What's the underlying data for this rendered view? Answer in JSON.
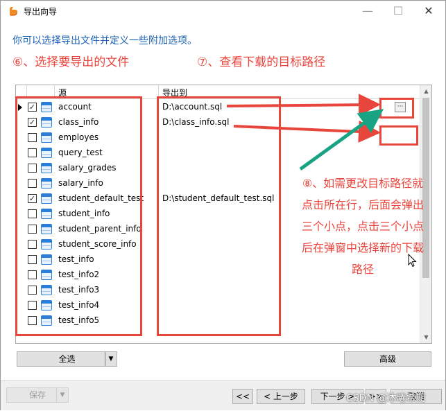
{
  "window": {
    "title": "导出向导"
  },
  "intro": "你可以选择导出文件并定义一些附加选项。",
  "annotations": {
    "step6": "⑥、选择要导出的文件",
    "step7": "⑦、查看下载的目标路径",
    "step8_lines": [
      "⑧、如需更改目标路径就",
      "点击所在行，后面会弹出",
      "三个小点，点击三个小点",
      "后在弹窗中选择新的下载",
      "路径"
    ]
  },
  "grid": {
    "headers": {
      "source": "源",
      "export_to": "导出到"
    },
    "rows": [
      {
        "name": "account",
        "checked": true,
        "dest": "D:\\account.sql",
        "current": true
      },
      {
        "name": "class_info",
        "checked": true,
        "dest": "D:\\class_info.sql"
      },
      {
        "name": "employes",
        "checked": false,
        "dest": ""
      },
      {
        "name": "query_test",
        "checked": false,
        "dest": ""
      },
      {
        "name": "salary_grades",
        "checked": false,
        "dest": ""
      },
      {
        "name": "salary_info",
        "checked": false,
        "dest": ""
      },
      {
        "name": "student_default_test",
        "checked": true,
        "dest": "D:\\student_default_test.sql"
      },
      {
        "name": "student_info",
        "checked": false,
        "dest": ""
      },
      {
        "name": "student_parent_info",
        "checked": false,
        "dest": ""
      },
      {
        "name": "student_score_info",
        "checked": false,
        "dest": ""
      },
      {
        "name": "test_info",
        "checked": false,
        "dest": ""
      },
      {
        "name": "test_info2",
        "checked": false,
        "dest": ""
      },
      {
        "name": "test_info3",
        "checked": false,
        "dest": ""
      },
      {
        "name": "test_info4",
        "checked": false,
        "dest": ""
      },
      {
        "name": "test_info5",
        "checked": false,
        "dest": ""
      }
    ],
    "ellipsis_label": "···"
  },
  "buttons": {
    "select_all": "全选",
    "advanced": "高级",
    "save": "保存",
    "first": "<<",
    "prev": "< 上一步",
    "next": "下一步 >",
    "last": ">>",
    "cancel": "取消"
  },
  "watermark": "CSDN @沐曦希期",
  "colors": {
    "annotation": "#e8453c",
    "intro": "#1a5fb4",
    "arrow": "#18a383"
  }
}
